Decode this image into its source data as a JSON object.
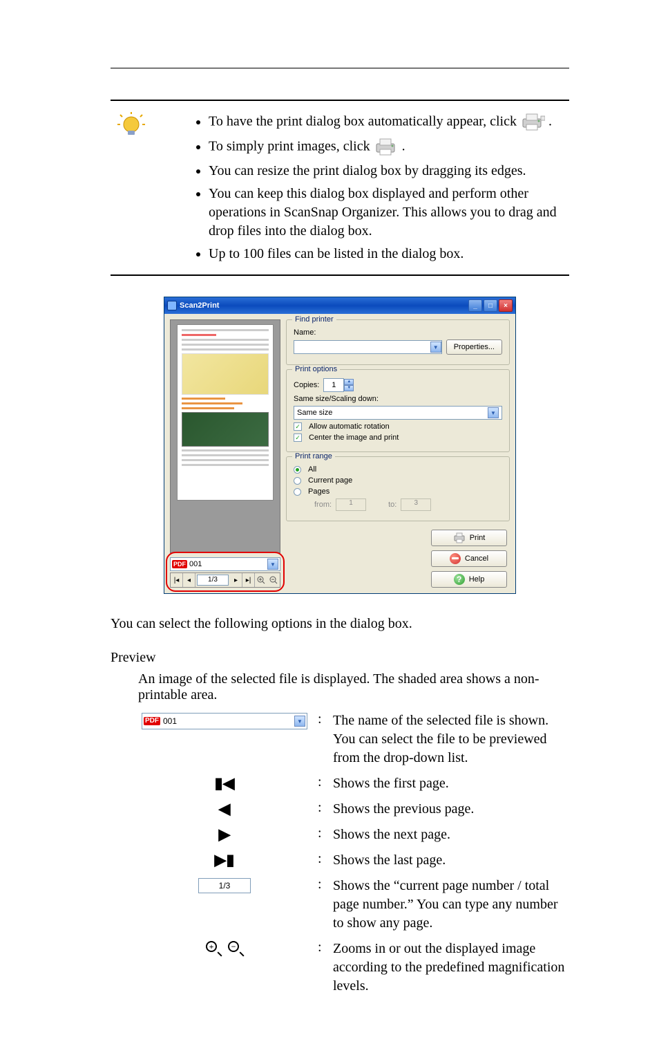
{
  "hint": {
    "items": [
      "To have the print dialog box automatically appear, click",
      "To simply print images, click",
      "You can resize the print dialog box by dragging its edges.",
      "You can keep this dialog box displayed and perform other operations in ScanSnap Organizer. This allows you to drag and drop files into the dialog box.",
      "Up to 100 files can be listed in the dialog box."
    ]
  },
  "dialog": {
    "title": "Scan2Print",
    "findPrinterTitle": "Find printer",
    "nameLabel": "Name:",
    "propertiesLabel": "Properties...",
    "printOptionsTitle": "Print options",
    "copiesLabel": "Copies:",
    "copiesValue": "1",
    "scalingLabel": "Same size/Scaling down:",
    "scalingValue": "Same size",
    "allowRotationLabel": "Allow automatic rotation",
    "centerLabel": "Center the image and print",
    "printRangeTitle": "Print range",
    "rangeAll": "All",
    "rangeCurrent": "Current page",
    "rangePages": "Pages",
    "fromLabel": "from:",
    "fromValue": "1",
    "toLabel": "to:",
    "toValue": "3",
    "printBtn": "Print",
    "cancelBtn": "Cancel",
    "helpBtn": "Help",
    "fileName": "001",
    "pageIndicator": "1/3"
  },
  "body": {
    "optionsIntro": "You can select the following options in the dialog box.",
    "previewHeader": "Preview",
    "previewDesc": "An image of the selected file is displayed. The shaded area shows a non-printable area.",
    "rows": {
      "fileSelectDesc": "The name of the selected file is shown. You can select the file to be previewed from the drop-down list.",
      "firstDesc": "Shows the first page.",
      "prevDesc": "Shows the previous page.",
      "nextDesc": "Shows the next page.",
      "lastDesc": "Shows the last page.",
      "pageBoxDesc": "Shows the “current page number / total page number.” You can type any number to show any page.",
      "zoomDesc": "Zooms in or out the displayed image according to the predefined magnification levels.",
      "pageBoxValue": "1/3",
      "fileSelectValue": "001"
    }
  }
}
